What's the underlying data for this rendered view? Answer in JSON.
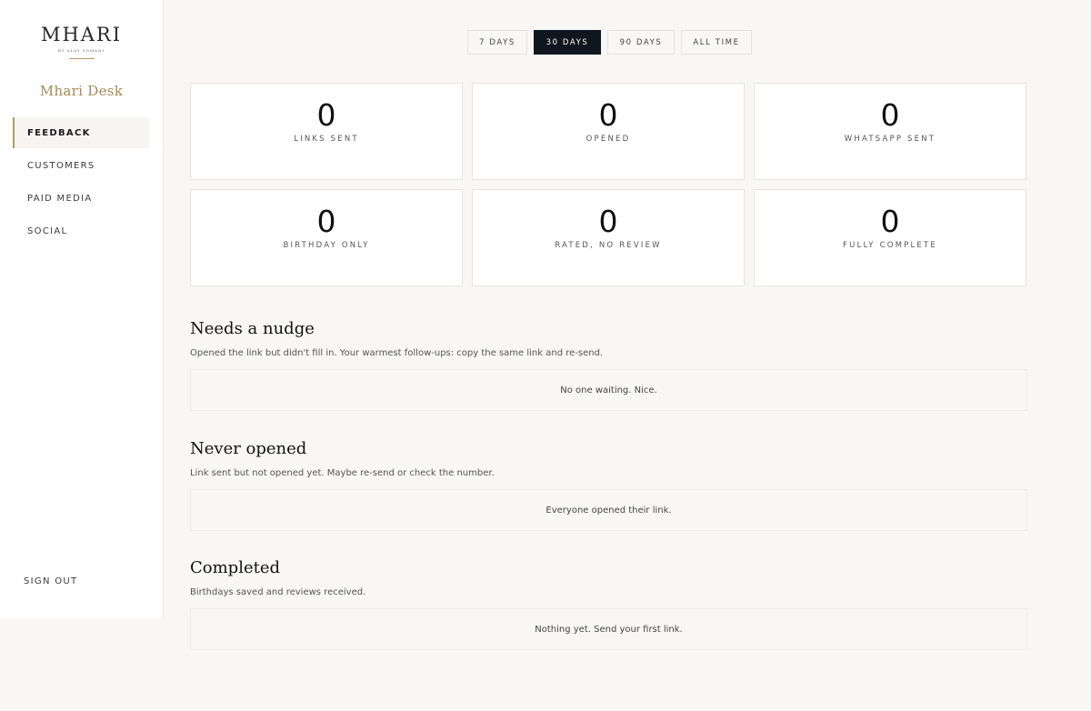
{
  "sidebar": {
    "logo": {
      "wordmark": "MHARI",
      "tagline": "BY ALAY SOMANI"
    },
    "brand": "Mhari Desk",
    "nav": [
      {
        "label": "FEEDBACK",
        "active": true
      },
      {
        "label": "CUSTOMERS",
        "active": false
      },
      {
        "label": "PAID MEDIA",
        "active": false
      },
      {
        "label": "SOCIAL",
        "active": false
      }
    ],
    "sign_out": "SIGN OUT"
  },
  "range": {
    "options": [
      "7 DAYS",
      "30 DAYS",
      "90 DAYS",
      "ALL TIME"
    ],
    "selected": "30 DAYS"
  },
  "stats": [
    {
      "value": "0",
      "label": "LINKS SENT"
    },
    {
      "value": "0",
      "label": "OPENED"
    },
    {
      "value": "0",
      "label": "WHATSAPP SENT"
    },
    {
      "value": "0",
      "label": "BIRTHDAY ONLY"
    },
    {
      "value": "0",
      "label": "RATED, NO REVIEW"
    },
    {
      "value": "0",
      "label": "FULLY COMPLETE"
    }
  ],
  "sections": [
    {
      "title": "Needs a nudge",
      "description": "Opened the link but didn't fill in. Your warmest follow-ups: copy the same link and re-send.",
      "empty": "No one waiting. Nice."
    },
    {
      "title": "Never opened",
      "description": "Link sent but not opened yet. Maybe re-send or check the number.",
      "empty": "Everyone opened their link."
    },
    {
      "title": "Completed",
      "description": "Birthdays saved and reviews received.",
      "empty": "Nothing yet. Send your first link."
    }
  ],
  "colors": {
    "accent": "#b39a6a",
    "active_button": "#0f161d",
    "background": "#f8f7f5"
  }
}
